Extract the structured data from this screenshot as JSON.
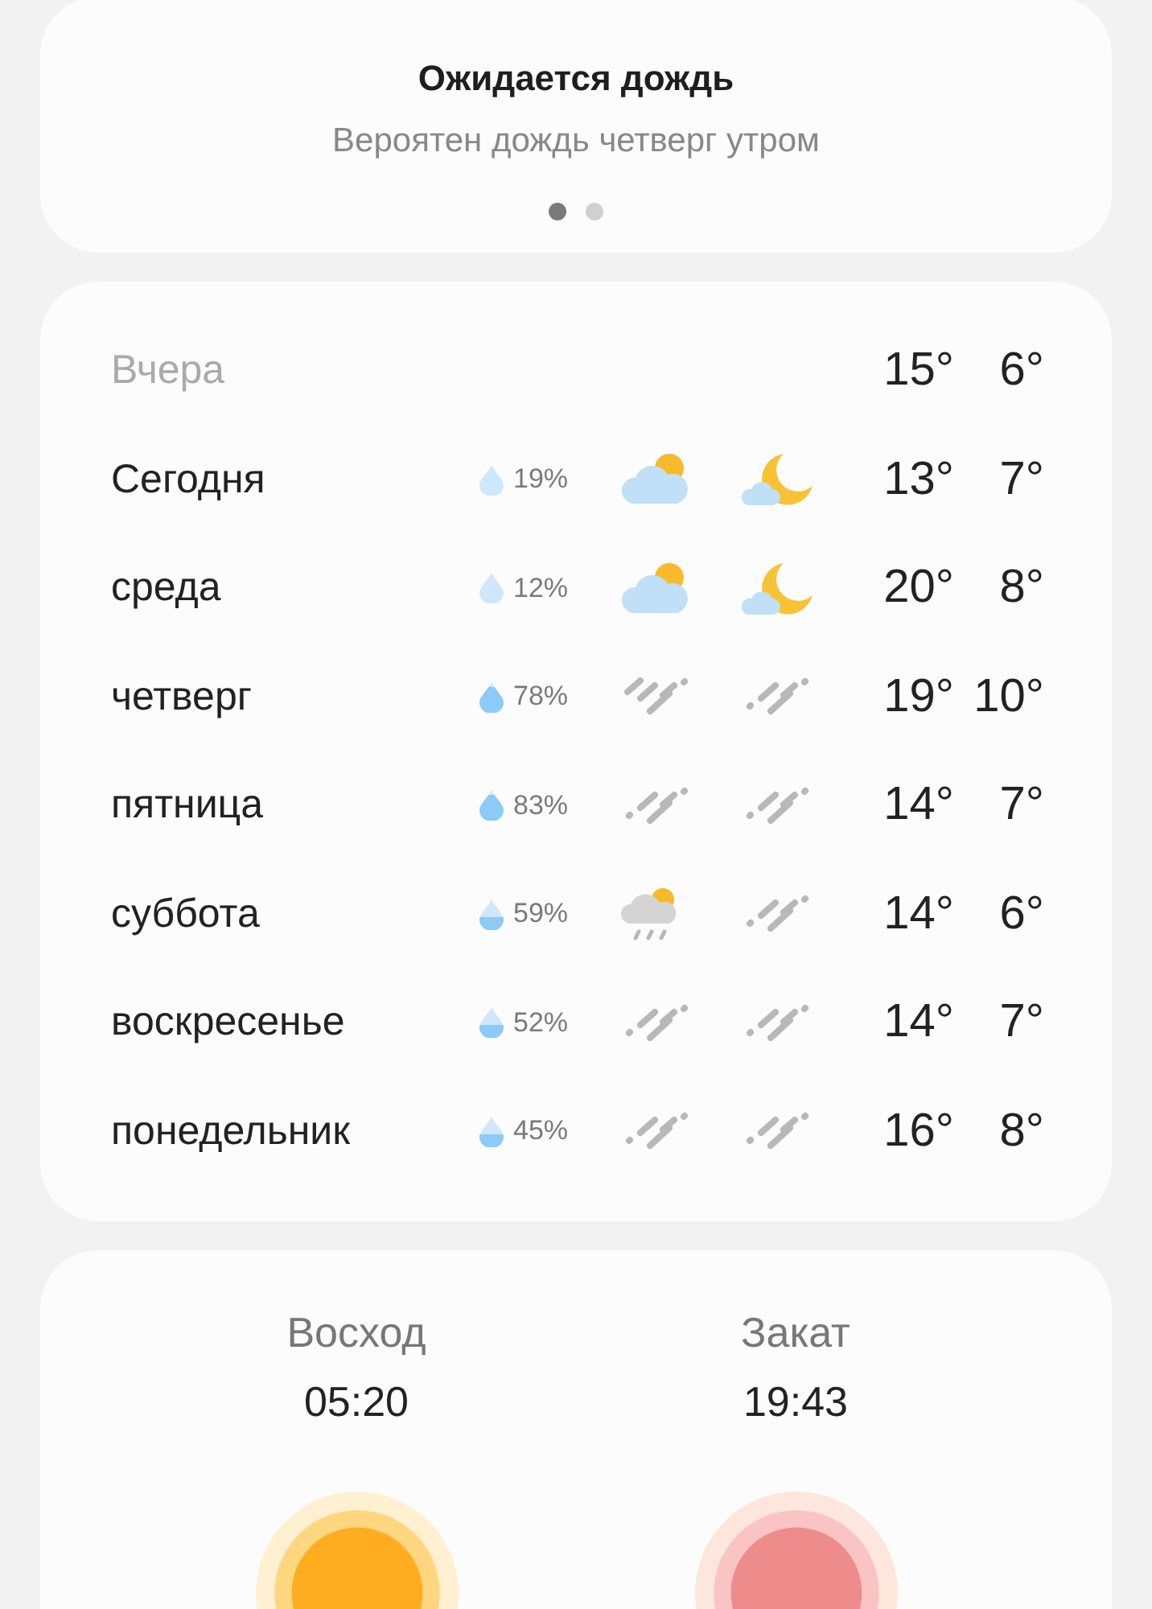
{
  "alert": {
    "title": "Ожидается дождь",
    "subtitle": "Вероятен дождь четверг утром",
    "dots": [
      {
        "selected": true
      },
      {
        "selected": false
      }
    ]
  },
  "forecast": [
    {
      "day": "Вчера",
      "past": true,
      "high": "15°",
      "low": "6°"
    },
    {
      "day": "Сегодня",
      "past": false,
      "precip": "19%",
      "drop": {
        "kind": "pale"
      },
      "day_icon": {
        "kind": "partly_cloudy"
      },
      "night_icon": {
        "kind": "night_cloudy"
      },
      "high": "13°",
      "low": "7°"
    },
    {
      "day": "среда",
      "past": false,
      "precip": "12%",
      "drop": {
        "kind": "pale"
      },
      "day_icon": {
        "kind": "partly_cloudy"
      },
      "night_icon": {
        "kind": "night_cloudy"
      },
      "high": "20°",
      "low": "8°"
    },
    {
      "day": "четверг",
      "past": false,
      "precip": "78%",
      "drop": {
        "kind": "full"
      },
      "day_icon": {
        "kind": "heavy_rain"
      },
      "night_icon": {
        "kind": "rain"
      },
      "high": "19°",
      "low": "10°"
    },
    {
      "day": "пятница",
      "past": false,
      "precip": "83%",
      "drop": {
        "kind": "full"
      },
      "day_icon": {
        "kind": "rain"
      },
      "night_icon": {
        "kind": "rain"
      },
      "high": "14°",
      "low": "7°"
    },
    {
      "day": "суббота",
      "past": false,
      "precip": "59%",
      "drop": {
        "kind": "half"
      },
      "day_icon": {
        "kind": "sun_shower"
      },
      "night_icon": {
        "kind": "rain"
      },
      "high": "14°",
      "low": "6°"
    },
    {
      "day": "воскресенье",
      "past": false,
      "precip": "52%",
      "drop": {
        "kind": "half"
      },
      "day_icon": {
        "kind": "rain"
      },
      "night_icon": {
        "kind": "rain"
      },
      "high": "14°",
      "low": "7°"
    },
    {
      "day": "понедельник",
      "past": false,
      "precip": "45%",
      "drop": {
        "kind": "half"
      },
      "day_icon": {
        "kind": "rain"
      },
      "night_icon": {
        "kind": "rain"
      },
      "high": "16°",
      "low": "8°"
    }
  ],
  "sun": [
    {
      "label": "Восход",
      "time": "05:20",
      "kind": "sunrise"
    },
    {
      "label": "Закат",
      "time": "19:43",
      "kind": "sunset"
    }
  ]
}
